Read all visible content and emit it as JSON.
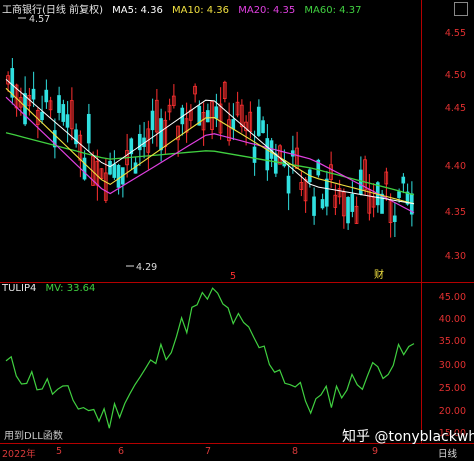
{
  "main": {
    "title": "工商银行(日线 前复权)",
    "ma_labels": [
      {
        "text": "MA5: 4.36",
        "color": "#ffffff"
      },
      {
        "text": "MA10: 4.36",
        "color": "#f0e040"
      },
      {
        "text": "MA20: 4.35",
        "color": "#e040e0"
      },
      {
        "text": "MA60: 4.37",
        "color": "#40d040"
      }
    ],
    "price_ticks": [
      "4.55",
      "4.50",
      "4.45",
      "4.40",
      "4.35",
      "4.30"
    ],
    "high_label": "4.57",
    "low_label": "4.29",
    "month_marker": "5",
    "cai_marker": "财"
  },
  "indicator": {
    "name": "TULIP4",
    "mv_label": "MV: 33.64",
    "ticks": [
      "45.00",
      "40.00",
      "35.00",
      "30.00",
      "25.00",
      "20.00",
      "15.00"
    ],
    "footer_note": "用到DLL函数"
  },
  "axis": {
    "dates": [
      "2022年",
      "5",
      "6",
      "7",
      "8",
      "9"
    ],
    "period_label": "日线"
  },
  "watermark": "知乎 @tonyblackwhite",
  "colors": {
    "up": "#ff3030",
    "down": "#30e0e0",
    "bg": "#000000",
    "grid": "#b40000",
    "indicator_line": "#40d040"
  },
  "chart_data": [
    {
      "type": "line",
      "title": "",
      "xlabel": "",
      "ylabel": "",
      "ylim": [
        4.27,
        4.58
      ],
      "x": [
        "5",
        "6",
        "7",
        "8",
        "9"
      ],
      "series": [
        {
          "name": "MA5",
          "values": [
            4.5,
            4.4,
            4.48,
            4.38,
            4.36
          ]
        },
        {
          "name": "MA10",
          "values": [
            4.49,
            4.38,
            4.46,
            4.39,
            4.36
          ]
        },
        {
          "name": "MA20",
          "values": [
            4.48,
            4.37,
            4.44,
            4.41,
            4.35
          ]
        },
        {
          "name": "MA60",
          "values": [
            4.44,
            4.41,
            4.42,
            4.4,
            4.37
          ]
        }
      ]
    },
    {
      "type": "line",
      "title": "",
      "xlabel": "",
      "ylabel": "",
      "ylim": [
        13,
        48
      ],
      "x": [
        "5",
        "6",
        "7",
        "8",
        "9"
      ],
      "series": [
        {
          "name": "MV",
          "values": [
            30,
            18,
            46,
            21,
            33.64
          ]
        }
      ]
    }
  ]
}
